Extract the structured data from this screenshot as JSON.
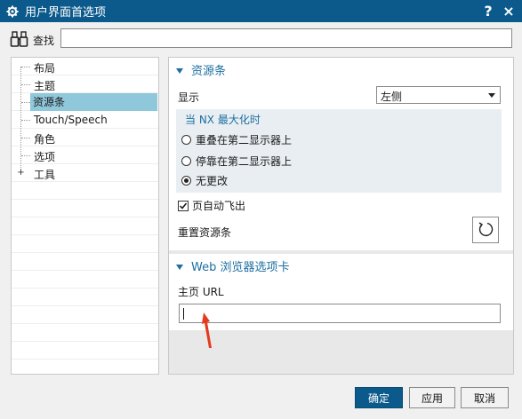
{
  "window": {
    "title": "用户界面首选项",
    "help_label": "?",
    "close_label": "×"
  },
  "search": {
    "label": "查找",
    "value": "",
    "placeholder": ""
  },
  "tree": {
    "items": [
      {
        "label": "布局",
        "selected": false,
        "expandable": false
      },
      {
        "label": "主题",
        "selected": false,
        "expandable": false
      },
      {
        "label": "资源条",
        "selected": true,
        "expandable": false
      },
      {
        "label": "Touch/Speech",
        "selected": false,
        "expandable": false
      },
      {
        "label": "角色",
        "selected": false,
        "expandable": false
      },
      {
        "label": "选项",
        "selected": false,
        "expandable": false
      },
      {
        "label": "工具",
        "selected": false,
        "expandable": true
      }
    ]
  },
  "resource_bar": {
    "section_title": "资源条",
    "display_label": "显示",
    "display_value": "左侧",
    "group_title": "当 NX 最大化时",
    "options": [
      {
        "label": "重叠在第二显示器上",
        "checked": false
      },
      {
        "label": "停靠在第二显示器上",
        "checked": false
      },
      {
        "label": "无更改",
        "checked": true
      }
    ],
    "auto_flyout_label": "页自动飞出",
    "auto_flyout_checked": true,
    "reset_label": "重置资源条"
  },
  "web_browser": {
    "section_title": "Web 浏览器选项卡",
    "home_url_label": "主页 URL",
    "home_url_value": ""
  },
  "buttons": {
    "ok": "确定",
    "apply": "应用",
    "cancel": "取消"
  },
  "colors": {
    "titlebar": "#0c5a8c",
    "accent": "#1d6fa0",
    "selection": "#8fc7db",
    "annotation_arrow": "#e53a1e"
  }
}
